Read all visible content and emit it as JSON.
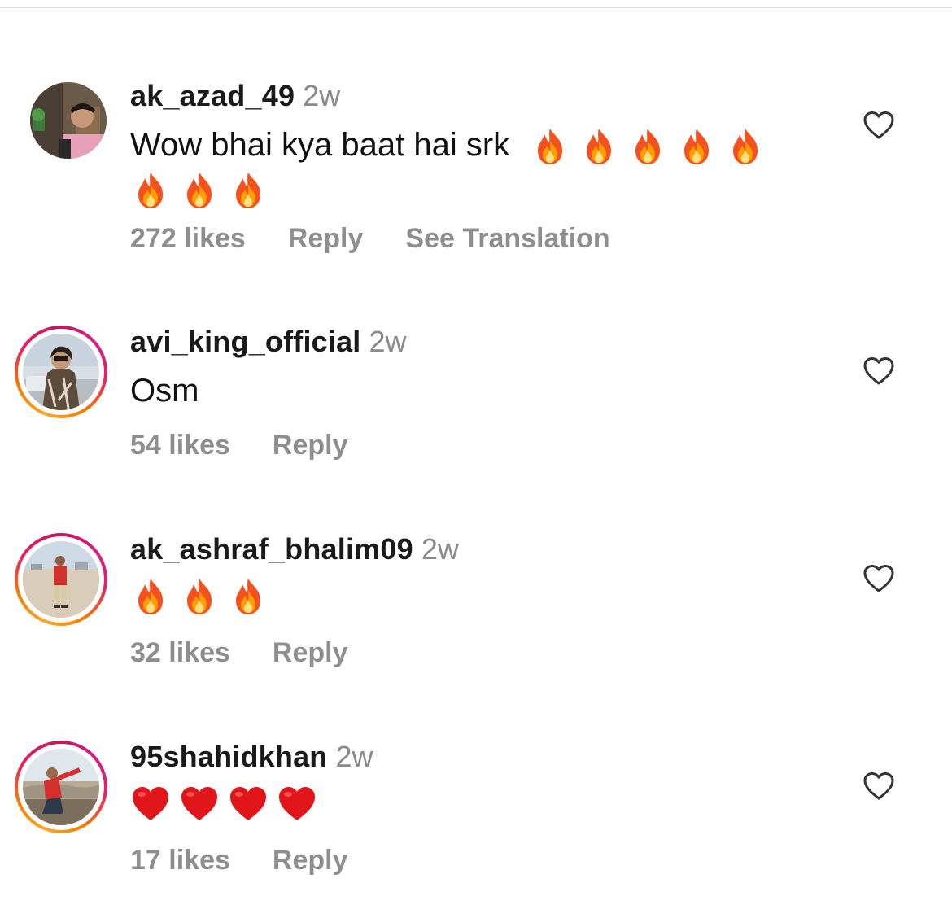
{
  "comments": [
    {
      "username": "ak_azad_49",
      "age": "2w",
      "text": "Wow bhai kya baat hai srk",
      "emojis": [
        "fire-emoji",
        "fire-emoji",
        "fire-emoji",
        "fire-emoji",
        "fire-emoji",
        "fire-emoji",
        "fire-emoji",
        "fire-emoji"
      ],
      "likes": "272 likes",
      "reply": "Reply",
      "translate": "See Translation",
      "story_ring": false
    },
    {
      "username": "avi_king_official",
      "age": "2w",
      "text": "Osm",
      "emojis": [],
      "likes": "54 likes",
      "reply": "Reply",
      "story_ring": true
    },
    {
      "username": "ak_ashraf_bhalim09",
      "age": "2w",
      "text": "",
      "emojis": [
        "fire-emoji",
        "fire-emoji",
        "fire-emoji"
      ],
      "likes": "32 likes",
      "reply": "Reply",
      "story_ring": true
    },
    {
      "username": "95shahidkhan",
      "age": "2w",
      "text": "",
      "emojis": [
        "red-heart-emoji",
        "red-heart-emoji",
        "red-heart-emoji",
        "red-heart-emoji"
      ],
      "likes": "17 likes",
      "reply": "Reply",
      "story_ring": true
    }
  ],
  "icons": {
    "like": "heart-outline-icon"
  },
  "colors": {
    "secondary_text": "#8e8e8e",
    "primary_text": "#111111",
    "story_ring_start": "#f9a825",
    "story_ring_end": "#d81b8c"
  }
}
